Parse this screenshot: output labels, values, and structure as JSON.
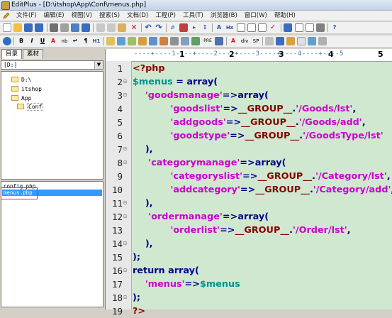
{
  "window": {
    "title": "EditPlus - [D:\\itshop\\App\\Conf\\menus.php]"
  },
  "menu": [
    "文件(F)",
    "编辑(E)",
    "视图(V)",
    "搜索(S)",
    "文档(D)",
    "工程(P)",
    "工具(T)",
    "浏览器(B)",
    "窗口(W)",
    "帮助(H)"
  ],
  "toolbar2_labels": {
    "bold": "B",
    "italic": "I",
    "underline": "U",
    "nb": "nb",
    "para": "¶",
    "h1": "H1",
    "pre": "PRE",
    "div": "div",
    "sp": "SP",
    "hx": "Hx"
  },
  "left": {
    "tabs": [
      "目录",
      "素材"
    ],
    "drive": "[D:]",
    "tree": [
      "D:\\",
      "itshop",
      "App",
      "Conf"
    ],
    "files": [
      "config.php",
      "menus.php"
    ]
  },
  "ruler": {
    "marks": [
      "1",
      "2",
      "3",
      "4",
      "5"
    ],
    "pattern": "----+----1----+----2----+----3----+----4----+----5"
  },
  "code": {
    "line_numbers": [
      "1",
      "2",
      "3",
      "4",
      "5",
      "6",
      "7",
      "8",
      "9",
      "10",
      "11",
      "12",
      "13",
      "14",
      "15",
      "16",
      "17",
      "18",
      "19"
    ],
    "lines": [
      [
        {
          "t": "<?php",
          "c": "tag"
        }
      ],
      [
        {
          "t": "$menus",
          "c": "var"
        },
        {
          "t": " = ",
          "c": "op"
        },
        {
          "t": "array",
          "c": "kw"
        },
        {
          "t": "(",
          "c": "op"
        }
      ],
      [
        {
          "t": "    'goodsmanage'",
          "c": "str"
        },
        {
          "t": "=>",
          "c": "op"
        },
        {
          "t": "array",
          "c": "kw"
        },
        {
          "t": "(",
          "c": "op"
        }
      ],
      [
        {
          "t": "            'goodslist'",
          "c": "str"
        },
        {
          "t": "=>",
          "c": "op"
        },
        {
          "t": "__GROUP__",
          "c": "const"
        },
        {
          "t": ".",
          "c": "op"
        },
        {
          "t": "'/Goods/lst'",
          "c": "str"
        },
        {
          "t": ",",
          "c": "op"
        }
      ],
      [
        {
          "t": "            'addgoods'",
          "c": "str"
        },
        {
          "t": "=>",
          "c": "op"
        },
        {
          "t": "__GROUP__",
          "c": "const"
        },
        {
          "t": ".",
          "c": "op"
        },
        {
          "t": "'/Goods/add'",
          "c": "str"
        },
        {
          "t": ",",
          "c": "op"
        }
      ],
      [
        {
          "t": "            'goodstype'",
          "c": "str"
        },
        {
          "t": "=>",
          "c": "op"
        },
        {
          "t": "__GROUP__",
          "c": "const"
        },
        {
          "t": ".",
          "c": "op"
        },
        {
          "t": "'/GoodsType/lst'",
          "c": "str"
        }
      ],
      [
        {
          "t": "    ),",
          "c": "op"
        }
      ],
      [
        {
          "t": "     'categorymanage'",
          "c": "str"
        },
        {
          "t": "=>",
          "c": "op"
        },
        {
          "t": "array",
          "c": "kw"
        },
        {
          "t": "(",
          "c": "op"
        }
      ],
      [
        {
          "t": "            'categoryslist'",
          "c": "str"
        },
        {
          "t": "=>",
          "c": "op"
        },
        {
          "t": "__GROUP__",
          "c": "const"
        },
        {
          "t": ".",
          "c": "op"
        },
        {
          "t": "'/Category/lst'",
          "c": "str"
        },
        {
          "t": ",",
          "c": "op"
        }
      ],
      [
        {
          "t": "            'addcategory'",
          "c": "str"
        },
        {
          "t": "=>",
          "c": "op"
        },
        {
          "t": "__GROUP__",
          "c": "const"
        },
        {
          "t": ".",
          "c": "op"
        },
        {
          "t": "'/Category/add'",
          "c": "str"
        },
        {
          "t": ",",
          "c": "op"
        }
      ],
      [
        {
          "t": "    ),",
          "c": "op"
        }
      ],
      [
        {
          "t": "     'ordermanage'",
          "c": "str"
        },
        {
          "t": "=>",
          "c": "op"
        },
        {
          "t": "array",
          "c": "kw"
        },
        {
          "t": "(",
          "c": "op"
        }
      ],
      [
        {
          "t": "            'orderlist'",
          "c": "str"
        },
        {
          "t": "=>",
          "c": "op"
        },
        {
          "t": "__GROUP__",
          "c": "const"
        },
        {
          "t": ".",
          "c": "op"
        },
        {
          "t": "'/Order/lst'",
          "c": "str"
        },
        {
          "t": ",",
          "c": "op"
        }
      ],
      [
        {
          "t": "    ),",
          "c": "op"
        }
      ],
      [
        {
          "t": ");",
          "c": "op"
        }
      ],
      [
        {
          "t": "return ",
          "c": "kw"
        },
        {
          "t": "array",
          "c": "kw"
        },
        {
          "t": "(",
          "c": "op"
        }
      ],
      [
        {
          "t": "    'menus'",
          "c": "str"
        },
        {
          "t": "=>",
          "c": "op"
        },
        {
          "t": "$menus",
          "c": "var"
        }
      ],
      [
        {
          "t": ");",
          "c": "op"
        }
      ],
      [
        {
          "t": "?>",
          "c": "tag"
        }
      ]
    ],
    "fold_markers": {
      "2": "⊟",
      "3": "⊟",
      "7": "⊟",
      "8": "⊟",
      "11": "⊟",
      "12": "⊟",
      "14": "⊟",
      "16": "⊟",
      "18": "⊟"
    },
    "colors": {
      "background": "#cfe8cf",
      "keyword": "#000088",
      "string": "#cc00cc",
      "variable": "#009090",
      "constant": "#880000"
    }
  }
}
